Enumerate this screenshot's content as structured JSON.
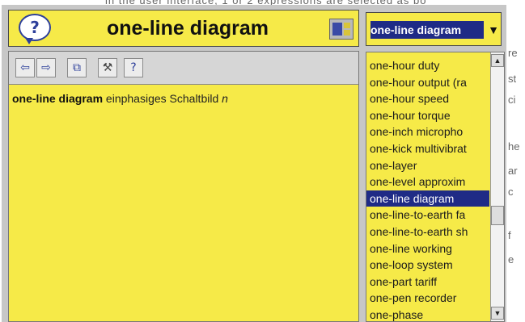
{
  "background": {
    "top_text": "in the user interface, 1 or 2 expressions are selected as bo",
    "right_fragments": [
      "re",
      "st",
      "ci",
      "he",
      "ar",
      "c",
      "f",
      "e"
    ]
  },
  "header": {
    "title": "one-line diagram"
  },
  "dropdown": {
    "value": "one-line diagram"
  },
  "toolbar": {
    "buttons": [
      {
        "name": "back-button",
        "icon": "arrow-left-icon",
        "glyph": "⇦"
      },
      {
        "name": "forward-button",
        "icon": "arrow-right-icon",
        "glyph": "⇨"
      },
      {
        "name": "copy-button",
        "icon": "copy-icon",
        "glyph": "⧉"
      },
      {
        "name": "tools-button",
        "icon": "hammer-icon",
        "glyph": "⚒"
      },
      {
        "name": "help-button",
        "icon": "question-icon",
        "glyph": "?"
      }
    ]
  },
  "entry": {
    "term": "one-line diagram",
    "translation": "einphasiges Schaltbild",
    "note_glyph": "n"
  },
  "wordlist": {
    "items": [
      "one-hour duty",
      "one-hour output (ra",
      "one-hour speed",
      "one-hour torque",
      "one-inch micropho",
      "one-kick multivibrat",
      "one-layer",
      "one-level approxim",
      "one-line diagram",
      "one-line-to-earth fa",
      "one-line-to-earth sh",
      "one-line working",
      "one-loop system",
      "one-part tariff",
      "one-pen recorder",
      "one-phase"
    ],
    "selected_index": 8
  },
  "colors": {
    "panel_yellow": "#f6ea48",
    "selection_blue": "#1f2b86"
  }
}
